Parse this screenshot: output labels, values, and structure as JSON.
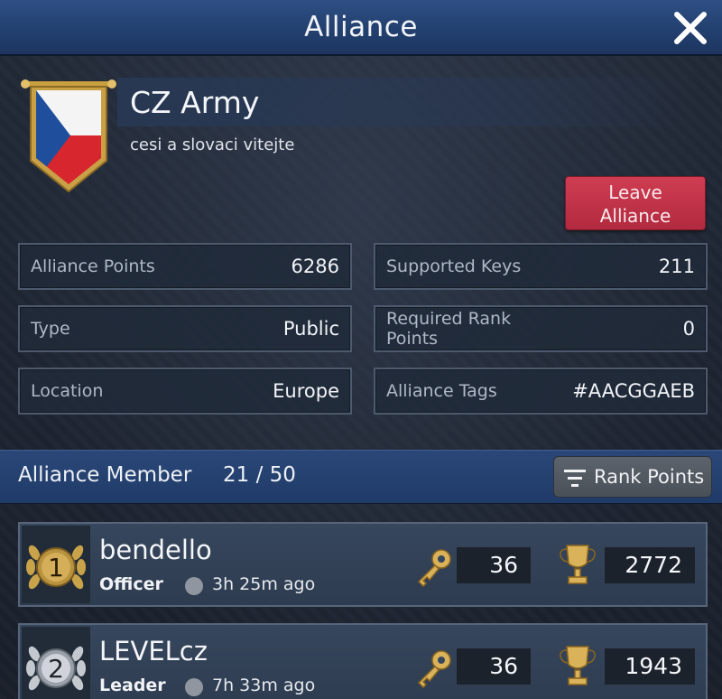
{
  "window": {
    "title": "Alliance"
  },
  "alliance": {
    "name": "CZ Army",
    "description": "cesi a slovaci vitejte",
    "leave_button": [
      "Leave",
      "Alliance"
    ]
  },
  "info": {
    "alliance_points": {
      "label": "Alliance Points",
      "value": "6286"
    },
    "supported_keys": {
      "label": "Supported Keys",
      "value": "211"
    },
    "type": {
      "label": "Type",
      "value": "Public"
    },
    "required_rank_points": {
      "label": "Required Rank Points",
      "value": "0"
    },
    "location": {
      "label": "Location",
      "value": "Europe"
    },
    "alliance_tags": {
      "label": "Alliance Tags",
      "value": "#AACGGAEB"
    }
  },
  "members": {
    "title": "Alliance Member",
    "count": "21 / 50",
    "sort_label": "Rank Points",
    "list": [
      {
        "rank": "1",
        "name": "bendello",
        "role": "Officer",
        "last_seen": "3h 25m  ago",
        "keys": "36",
        "points": "2772"
      },
      {
        "rank": "2",
        "name": "LEVELcz",
        "role": "Leader",
        "last_seen": "7h 33m  ago",
        "keys": "36",
        "points": "1943"
      }
    ]
  },
  "colors": {
    "title_bar": "#22406f",
    "leave_button": "#c2344a",
    "medal_gold": "#c9a34a",
    "medal_silver": "#c4c8cf",
    "online_dot": "#8f969f"
  },
  "icons": [
    "close-icon",
    "alliance-banner-icon",
    "sort-icon",
    "rank-medal-icon",
    "key-icon",
    "trophy-icon"
  ]
}
